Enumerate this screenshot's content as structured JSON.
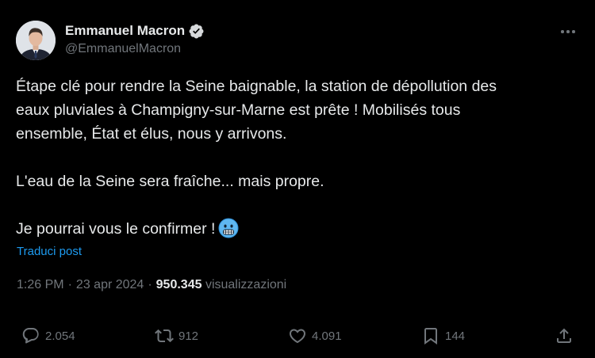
{
  "author": {
    "name": "Emmanuel Macron",
    "handle": "@EmmanuelMacron",
    "verified": true
  },
  "tweet": {
    "paragraphs": [
      [
        "Étape clé pour rendre la Seine baignable, la station de dépollution des",
        "eaux pluviales à Champigny-sur-Marne est prête ! Mobilisés tous",
        "ensemble, État et élus, nous y arrivons."
      ],
      [
        "L'eau de la Seine sera fraîche... mais propre."
      ],
      [
        "Je pourrai vous le confirmer !"
      ]
    ],
    "emoji": "cold-face-emoji",
    "translate_label": "Traduci post"
  },
  "meta": {
    "time": "1:26 PM",
    "date": "23 apr 2024",
    "views_count": "950.345",
    "views_label": "visualizzazioni"
  },
  "actions": {
    "replies": "2.054",
    "reposts": "912",
    "likes": "4.091",
    "bookmarks": "144"
  },
  "colors": {
    "background": "#000000",
    "text": "#e7e9ea",
    "secondary": "#71767b",
    "accent": "#1d9bf0"
  }
}
